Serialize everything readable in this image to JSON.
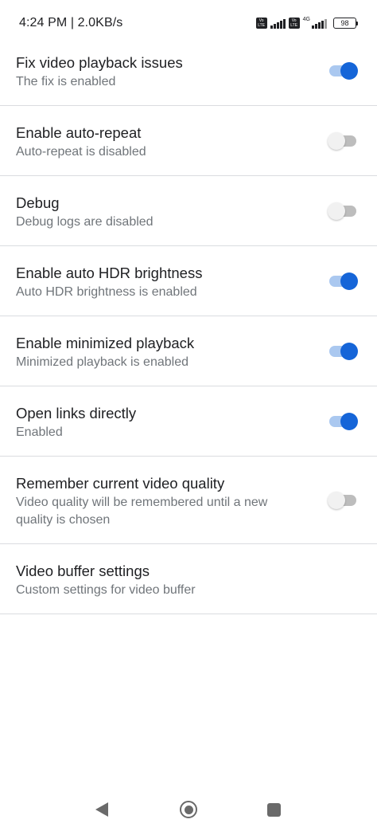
{
  "status_bar": {
    "time": "4:24 PM | 2.0KB/s",
    "volte1": "Vo LTE",
    "volte2": "Vo LTE",
    "network": "4G",
    "battery": "98"
  },
  "settings": [
    {
      "title": "Fix video playback issues",
      "summary": "The fix is enabled",
      "toggle": "on"
    },
    {
      "title": "Enable auto-repeat",
      "summary": "Auto-repeat is disabled",
      "toggle": "off"
    },
    {
      "title": "Debug",
      "summary": "Debug logs are disabled",
      "toggle": "off"
    },
    {
      "title": "Enable auto HDR brightness",
      "summary": "Auto HDR brightness is enabled",
      "toggle": "on"
    },
    {
      "title": "Enable minimized playback",
      "summary": "Minimized playback is enabled",
      "toggle": "on"
    },
    {
      "title": "Open links directly",
      "summary": "Enabled",
      "toggle": "on"
    },
    {
      "title": "Remember current video quality",
      "summary": "Video quality will be remembered until a new quality is chosen",
      "toggle": "off"
    },
    {
      "title": "Video buffer settings",
      "summary": "Custom settings for video buffer",
      "toggle": null
    }
  ],
  "colors": {
    "toggle_on_thumb": "#1565d8",
    "toggle_on_track": "#aac8f0",
    "toggle_off_thumb": "#f1f1f1",
    "toggle_off_track": "#bdbdbd"
  },
  "nav_bar": {
    "back_icon": "back-triangle-icon",
    "home_icon": "home-circle-icon",
    "recents_icon": "recents-square-icon"
  }
}
